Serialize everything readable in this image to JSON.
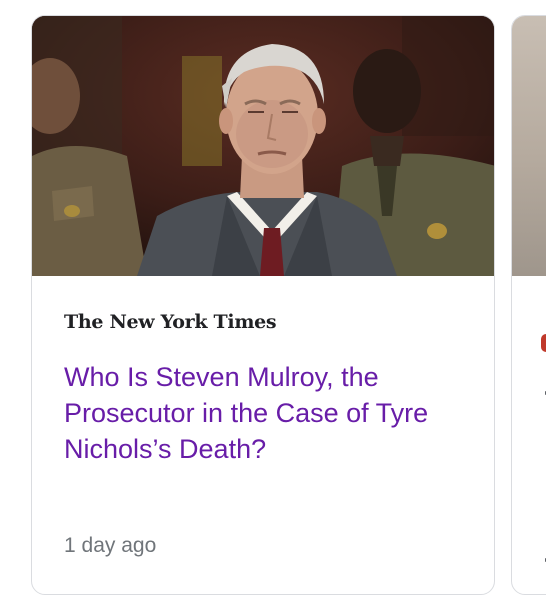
{
  "card": {
    "publisher": "The New York Times",
    "headline": "Who Is Steven Mulroy, the Prosecutor in the Case of Tyre Nichols’s Death?",
    "timestamp": "1 day ago"
  },
  "colors": {
    "headline": "#681da8",
    "publisher": "#202124",
    "timestamp": "#70757a",
    "card_border": "#dadce0",
    "next_card_accent": "#c0392b"
  }
}
